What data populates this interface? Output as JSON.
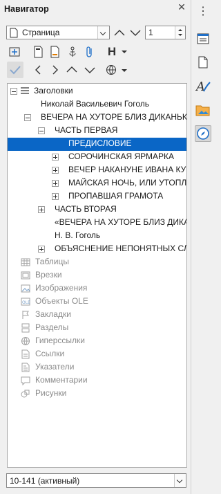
{
  "panel": {
    "title": "Навигатор",
    "navigate_by": "Страница",
    "page_number": "1",
    "document_selector": "10-141 (активный)"
  },
  "tree": {
    "root": "Заголовки",
    "items": [
      "Николай Васильевич Гоголь",
      "ВЕЧЕРА НА ХУТОРЕ БЛИЗ ДИКАНЬКИ",
      "ЧАСТЬ ПЕРВАЯ",
      "ПРЕДИСЛОВИЕ",
      "СОРОЧИНСКАЯ ЯРМАРКА",
      "ВЕЧЕР НАКАНУНЕ ИВАНА КУП...",
      "МАЙСКАЯ НОЧЬ, ИЛИ УТОПЛЕ...",
      "ПРОПАВШАЯ ГРАМОТА",
      "ЧАСТЬ ВТОРАЯ",
      "«ВЕЧЕРА НА ХУТОРЕ БЛИЗ ДИКАН...",
      "Н. В. Гоголь",
      "ОБЪЯСНЕНИЕ НЕПОНЯТНЫХ СЛОВ..."
    ],
    "categories": [
      "Таблицы",
      "Врезки",
      "Изображения",
      "Объекты OLE",
      "Закладки",
      "Разделы",
      "Гиперссылки",
      "Ссылки",
      "Указатели",
      "Комментарии",
      "Рисунки"
    ]
  },
  "colors": {
    "selection": "#0a66c6",
    "accent": "#1f6fc8"
  }
}
